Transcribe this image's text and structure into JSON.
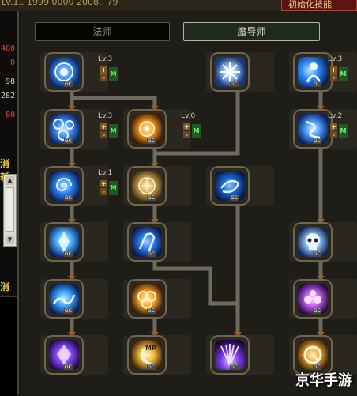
{
  "topbar": {
    "text": "LV.1..  1999  0000  2008..  79",
    "red_tab": "初始化技能"
  },
  "left_panel": {
    "stats": [
      {
        "value": "460",
        "color": "#e0463c"
      },
      {
        "value": "0",
        "color": "#e0463c"
      },
      {
        "value": "98",
        "color": "#d8d2c0"
      },
      {
        "value": "282",
        "color": "#d8d2c0"
      },
      {
        "value": "80",
        "color": "#e0463c"
      }
    ],
    "label_top": "消耗",
    "label_bottom": "消耗",
    "scroll_up": "▲",
    "scroll_down": "▼"
  },
  "tabs": [
    {
      "label": "法师",
      "active": false
    },
    {
      "label": "魔导师",
      "active": true
    }
  ],
  "skill_controls": {
    "plus": "+",
    "minus": "-",
    "m": "M",
    "gc": "GC"
  },
  "skills": [
    {
      "id": "r1c1",
      "icon": "water-ring-icon",
      "level": "Lv.3",
      "hue": "#5aa8ff"
    },
    {
      "id": "r1c3",
      "icon": "lightning-burst-icon",
      "level": null,
      "hue": "#cfe8ff"
    },
    {
      "id": "r1c4",
      "icon": "figure-icon",
      "level": "Lv.3",
      "hue": "#3ea8ff"
    },
    {
      "id": "r2c1",
      "icon": "bubbles-icon",
      "level": "Lv.3",
      "hue": "#4ab0ff"
    },
    {
      "id": "r2c2",
      "icon": "orb-sun-icon",
      "level": "Lv.0",
      "hue": "#ffb238"
    },
    {
      "id": "r2c4",
      "icon": "whirlwind-icon",
      "level": "Lv.2",
      "hue": "#6ab0ff"
    },
    {
      "id": "r3c1",
      "icon": "vortex-icon",
      "level": "Lv.1",
      "hue": "#3aa0ff"
    },
    {
      "id": "r3c2",
      "icon": "rune-circle-icon",
      "level": null,
      "hue": "#e8c068"
    },
    {
      "id": "r3c3",
      "icon": "swirl-wind-icon",
      "level": null,
      "hue": "#4aa0ff"
    },
    {
      "id": "r4c1",
      "icon": "ice-shard-icon",
      "level": null,
      "hue": "#5ab4ff"
    },
    {
      "id": "r4c2",
      "icon": "hook-icon",
      "level": null,
      "hue": "#3a8cff"
    },
    {
      "id": "r4c4",
      "icon": "skull-icon",
      "level": null,
      "hue": "#b8d8ff"
    },
    {
      "id": "r5c1",
      "icon": "wave-icon",
      "level": null,
      "hue": "#4ab8ff"
    },
    {
      "id": "r5c2",
      "icon": "sun-rings-icon",
      "level": null,
      "hue": "#ffb640"
    },
    {
      "id": "r5c4",
      "icon": "pink-orbs-icon",
      "level": null,
      "hue": "#d87aff"
    },
    {
      "id": "r6c1",
      "icon": "purple-crystal-icon",
      "level": null,
      "hue": "#a86aff"
    },
    {
      "id": "r6c2",
      "icon": "mp-moon-icon",
      "level": null,
      "hue": "#ffce5a",
      "mp": "MP"
    },
    {
      "id": "r6c3",
      "icon": "purple-burst-icon",
      "level": null,
      "hue": "#9a5aff"
    },
    {
      "id": "r6c4",
      "icon": "gold-ring-icon",
      "level": null,
      "hue": "#ffb840"
    }
  ],
  "watermark": "京华手游"
}
